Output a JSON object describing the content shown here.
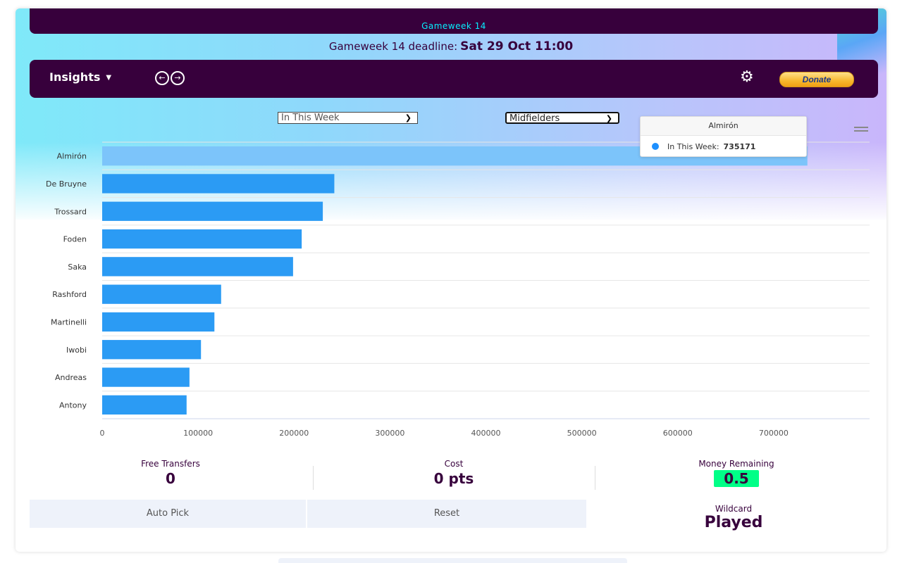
{
  "gameweek_banner": "Gameweek 14",
  "deadline": {
    "label": "Gameweek 14 deadline:",
    "value": "Sat 29 Oct 11:00"
  },
  "nav": {
    "menu_label": "Insights",
    "donate_label": "Donate"
  },
  "filters": {
    "period": "In This Week",
    "position": "Midfielders"
  },
  "tooltip": {
    "title": "Almirón",
    "series_label": "In This Week:",
    "value": "735171"
  },
  "chart_data": {
    "type": "bar",
    "orientation": "horizontal",
    "categories": [
      "Almirón",
      "De Bruyne",
      "Trossard",
      "Foden",
      "Saka",
      "Rashford",
      "Martinelli",
      "Iwobi",
      "Andreas",
      "Antony"
    ],
    "series": [
      {
        "name": "In This Week",
        "values": [
          735171,
          242000,
          230000,
          208000,
          199000,
          124000,
          117000,
          103000,
          91000,
          88000
        ]
      }
    ],
    "xlim": [
      0,
      800000
    ],
    "xticks": [
      0,
      100000,
      200000,
      300000,
      400000,
      500000,
      600000,
      700000
    ],
    "highlighted_index": 0,
    "grid": true,
    "colors": {
      "bar": "#2b9bf4",
      "bar_highlight": "#7cc4fa",
      "grid": "#e6e6e6"
    }
  },
  "stats": {
    "free_transfers": {
      "label": "Free Transfers",
      "value": "0"
    },
    "cost": {
      "label": "Cost",
      "value": "0 pts"
    },
    "money_remaining": {
      "label": "Money Remaining",
      "value": "0.5"
    }
  },
  "buttons": {
    "auto_pick": "Auto Pick",
    "reset": "Reset"
  },
  "wildcard": {
    "label": "Wildcard",
    "value": "Played"
  }
}
